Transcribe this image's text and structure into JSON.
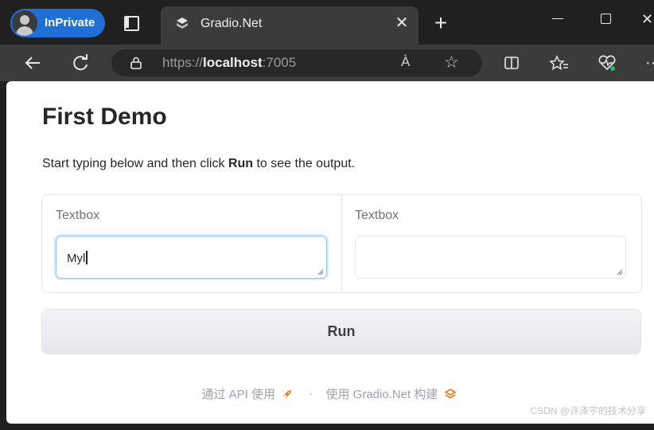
{
  "browser": {
    "profile_label": "InPrivate",
    "tab_title": "Gradio.Net",
    "tab_close": "✕",
    "new_tab": "+",
    "url_scheme": "https://",
    "url_host": "localhost",
    "url_port": ":7005",
    "read_aloud": "À",
    "favorite_star": "☆",
    "close_window": "✕",
    "more": "···"
  },
  "page": {
    "title": "First Demo",
    "desc_before": "Start typing below and then click ",
    "desc_bold": "Run",
    "desc_after": " to see the output.",
    "input_label": "Textbox",
    "input_value": "Myl",
    "output_label": "Textbox",
    "output_value": "",
    "run_label": "Run",
    "footer_api": "通过 API 使用",
    "footer_sep": "·",
    "footer_built": "使用 Gradio.Net 构建"
  },
  "watermark": "CSDN @许泽宇的技术分享",
  "colors": {
    "profile_pill": "#1f6fd6",
    "input_focus_border": "#93c5fd",
    "run_button": "#e5e7eb",
    "footer_icon_orange": "#f97316"
  },
  "icons": [
    "profile-avatar-icon",
    "tab-actions-icon",
    "gradio-favicon-icon",
    "back-arrow-icon",
    "refresh-icon",
    "lock-icon",
    "read-aloud-icon",
    "favorite-star-icon",
    "split-screen-icon",
    "favorites-icon",
    "browser-essentials-icon",
    "rocket-icon",
    "gradio-logo-icon"
  ]
}
